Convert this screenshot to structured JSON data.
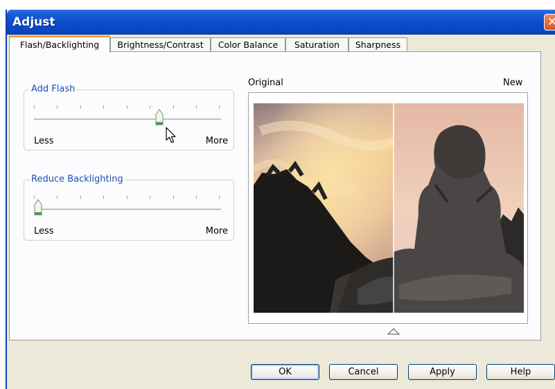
{
  "window": {
    "title": "Adjust",
    "close_symbol": "✕"
  },
  "tabs": [
    {
      "label": "Flash/Backlighting",
      "active": true
    },
    {
      "label": "Brightness/Contrast",
      "active": false
    },
    {
      "label": "Color Balance",
      "active": false
    },
    {
      "label": "Saturation",
      "active": false
    },
    {
      "label": "Sharpness",
      "active": false
    }
  ],
  "add_flash": {
    "title": "Add Flash",
    "min_label": "Less",
    "max_label": "More",
    "value": 0.68
  },
  "reduce_backlighting": {
    "title": "Reduce Backlighting",
    "min_label": "Less",
    "max_label": "More",
    "value": 0.0
  },
  "preview": {
    "left_label": "Original",
    "right_label": "New",
    "split": 0.52
  },
  "buttons": {
    "ok": "OK",
    "cancel": "Cancel",
    "apply": "Apply",
    "help": "Help"
  },
  "colors": {
    "titlebar": "#0b4bc9",
    "active_tab_accent": "#f1a43b",
    "group_title": "#1a4fb5",
    "dialog_bg": "#ece9d8"
  }
}
